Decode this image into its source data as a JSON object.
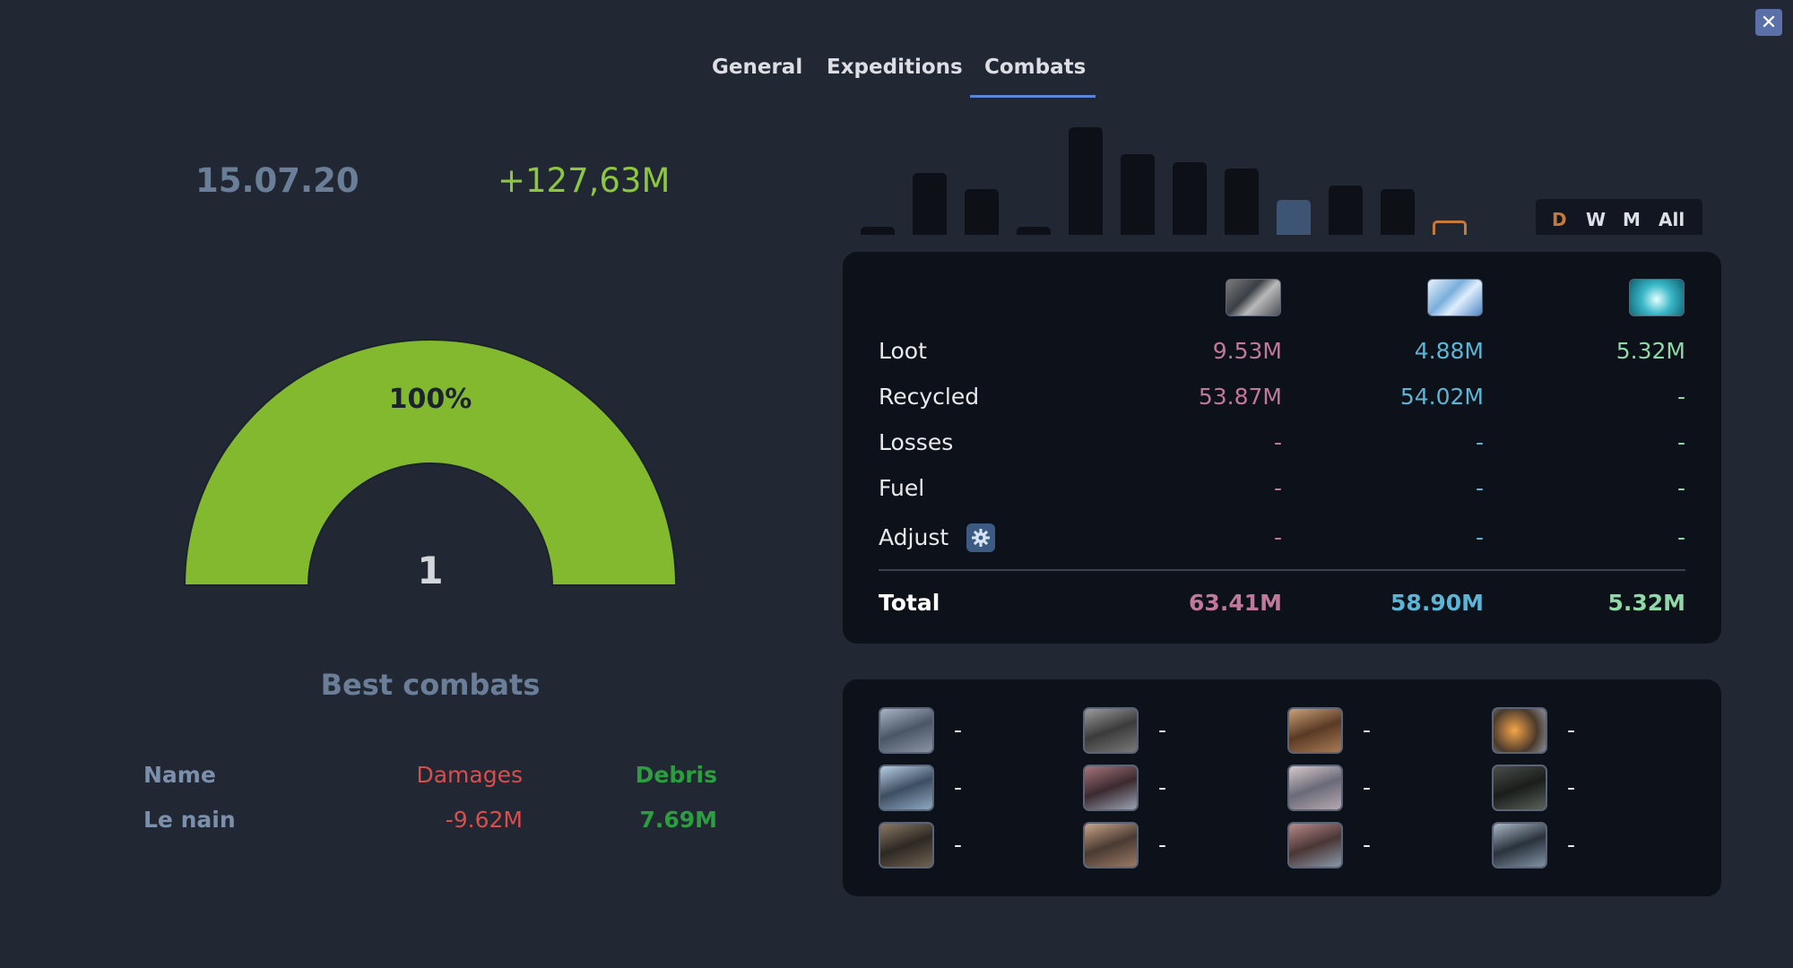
{
  "close_label": "✕",
  "tabs": [
    {
      "label": "General",
      "active": false
    },
    {
      "label": "Expeditions",
      "active": false
    },
    {
      "label": "Combats",
      "active": true
    }
  ],
  "summary": {
    "date": "15.07.20",
    "gain": "+127,63M"
  },
  "gauge": {
    "percent": "100%",
    "count": "1",
    "fill": 1.0,
    "color": "#82b92e"
  },
  "best_combats": {
    "title": "Best combats",
    "headers": {
      "name": "Name",
      "damages": "Damages",
      "debris": "Debris"
    },
    "rows": [
      {
        "name": "Le nain",
        "damages": "-9.62M",
        "debris": "7.69M"
      }
    ]
  },
  "bar_history": {
    "values": [
      4,
      30,
      22,
      4,
      52,
      39,
      35,
      32,
      17,
      24,
      22,
      7
    ],
    "current_index": 8,
    "outline_index": 11
  },
  "periods": [
    {
      "label": "D",
      "active": true
    },
    {
      "label": "W",
      "active": false
    },
    {
      "label": "M",
      "active": false
    },
    {
      "label": "All",
      "active": false
    }
  ],
  "resources": {
    "icons": [
      "metal-icon",
      "crystal-icon",
      "deuterium-icon"
    ],
    "rows": [
      {
        "label": "Loot",
        "values": [
          "9.53M",
          "4.88M",
          "5.32M"
        ]
      },
      {
        "label": "Recycled",
        "values": [
          "53.87M",
          "54.02M",
          "-"
        ]
      },
      {
        "label": "Losses",
        "values": [
          "-",
          "-",
          "-"
        ]
      },
      {
        "label": "Fuel",
        "values": [
          "-",
          "-",
          "-"
        ]
      },
      {
        "label": "Adjust",
        "values": [
          "-",
          "-",
          "-"
        ]
      }
    ],
    "total": {
      "label": "Total",
      "values": [
        "63.41M",
        "58.90M",
        "5.32M"
      ]
    }
  },
  "ships": [
    {
      "icon": "light-fighter-icon",
      "value": "-"
    },
    {
      "icon": "heavy-fighter-icon",
      "value": "-"
    },
    {
      "icon": "cruiser-icon",
      "value": "-"
    },
    {
      "icon": "battleship-icon",
      "value": "-"
    },
    {
      "icon": "battlecruiser-icon",
      "value": "-"
    },
    {
      "icon": "bomber-icon",
      "value": "-"
    },
    {
      "icon": "destroyer-icon",
      "value": "-"
    },
    {
      "icon": "deathstar-icon",
      "value": "-"
    },
    {
      "icon": "reaper-icon",
      "value": "-"
    },
    {
      "icon": "pathfinder-icon",
      "value": "-"
    },
    {
      "icon": "small-cargo-icon",
      "value": "-"
    },
    {
      "icon": "large-cargo-icon",
      "value": "-"
    }
  ]
}
